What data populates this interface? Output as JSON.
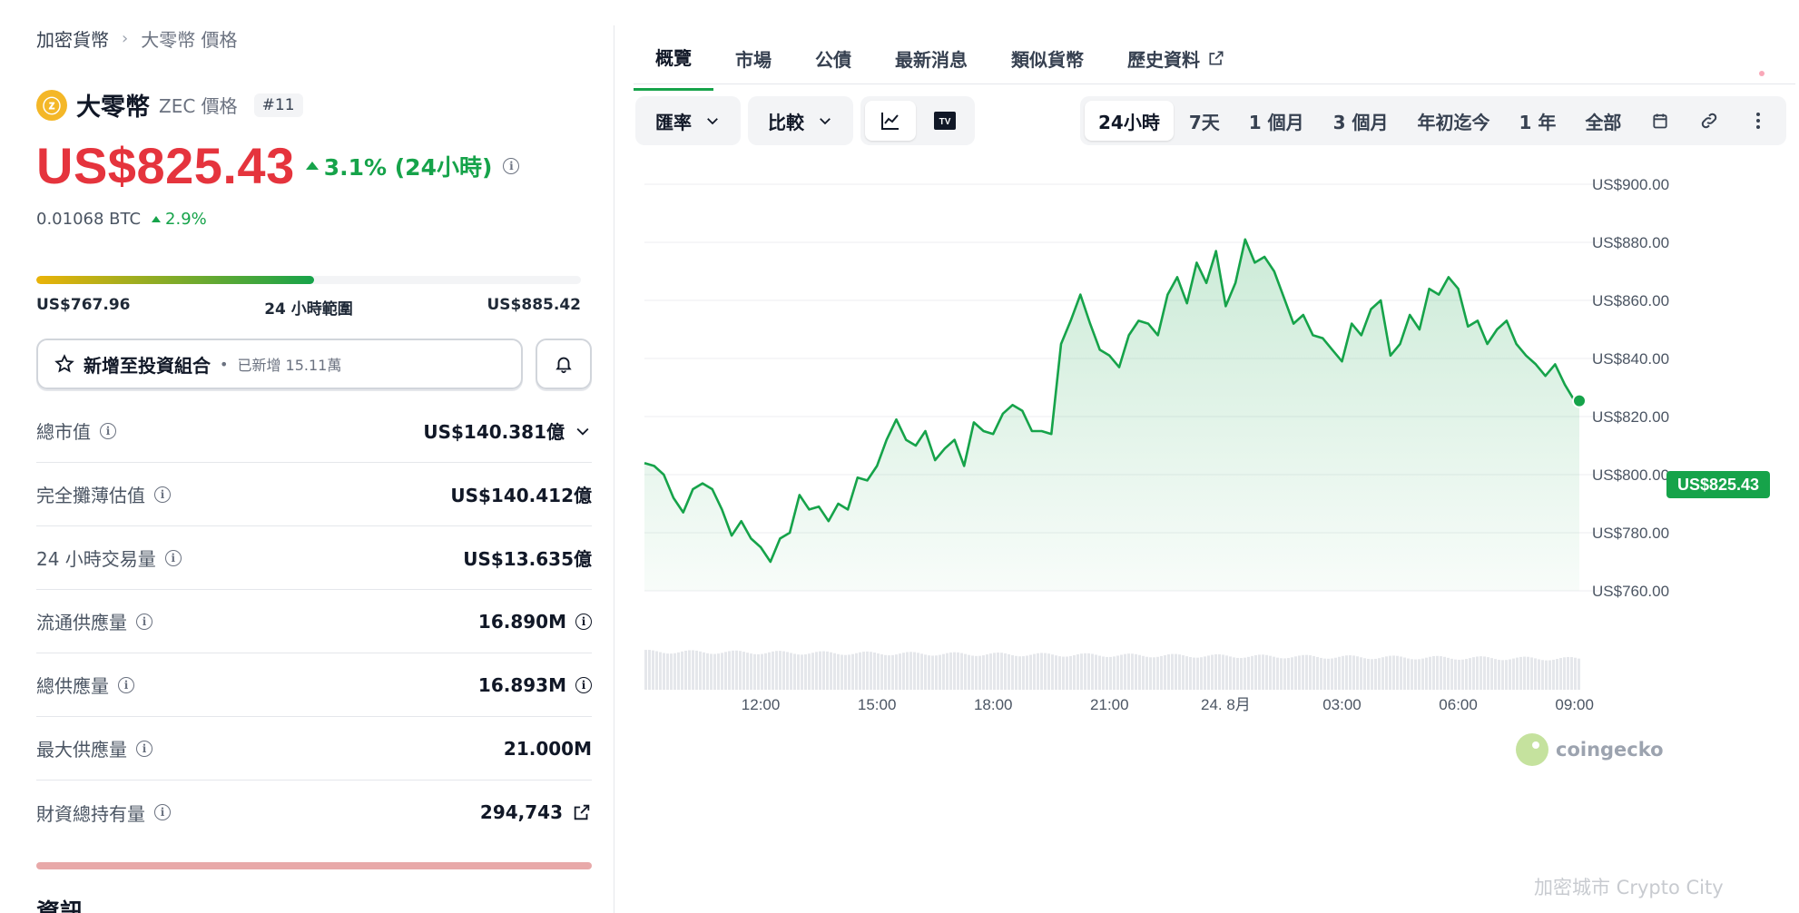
{
  "breadcrumb": {
    "root": "加密貨幣",
    "separator": "›",
    "current": "大零幣 價格"
  },
  "coin": {
    "logo_glyph": "ⓩ",
    "name": "大零幣",
    "symbol_label": "ZEC 價格",
    "rank": "#11",
    "logo_color": "#f4b728"
  },
  "price": {
    "value": "US$825.43",
    "change": "3.1% (24小時)",
    "btc_value": "0.01068 BTC",
    "btc_change": "2.9%"
  },
  "range_24h": {
    "low": "US$767.96",
    "label": "24 小時範圍",
    "high": "US$885.42",
    "position_fraction": 0.51
  },
  "portfolio": {
    "label": "新增至投資組合",
    "bullet": "•",
    "added": "已新增 15.11萬"
  },
  "stats": [
    {
      "key": "總市值",
      "value": "US$140.381億"
    },
    {
      "key": "完全攤薄估值",
      "value": "US$140.412億"
    },
    {
      "key": "24 小時交易量",
      "value": "US$13.635億"
    },
    {
      "key": "流通供應量",
      "value": "16.890M"
    },
    {
      "key": "總供應量",
      "value": "16.893M"
    },
    {
      "key": "最大供應量",
      "value": "21.000M"
    },
    {
      "key": "財資總持有量",
      "value": "294,743"
    }
  ],
  "section_heading": "資訊",
  "tabs": [
    "概覽",
    "市場",
    "公債",
    "最新消息",
    "類似貨幣",
    "歷史資料"
  ],
  "toolbar": {
    "currency_label": "匯率",
    "compare_label": "比較",
    "tv_label": "TV",
    "ranges": [
      "24小時",
      "7天",
      "1 個月",
      "3 個月",
      "年初迄今",
      "1 年",
      "全部"
    ],
    "selected_range": "24小時"
  },
  "chart_data": {
    "type": "line",
    "title": "",
    "xlabel": "",
    "ylabel": "",
    "ylim": [
      760,
      900
    ],
    "y_ticks": [
      "US$900.00",
      "US$880.00",
      "US$860.00",
      "US$840.00",
      "US$820.00",
      "US$800.00",
      "US$780.00",
      "US$760.00"
    ],
    "x_ticks": [
      "12:00",
      "15:00",
      "18:00",
      "21:00",
      "24. 8月",
      "03:00",
      "06:00",
      "09:00"
    ],
    "x_tick_hours": [
      12,
      15,
      18,
      21,
      24,
      27,
      30,
      33
    ],
    "x_hours": [
      9,
      9.25,
      9.5,
      9.75,
      10,
      10.25,
      10.5,
      10.75,
      11,
      11.25,
      11.5,
      11.75,
      12,
      12.25,
      12.5,
      12.75,
      13,
      13.25,
      13.5,
      13.75,
      14,
      14.25,
      14.5,
      14.75,
      15,
      15.25,
      15.5,
      15.75,
      16,
      16.25,
      16.5,
      16.75,
      17,
      17.25,
      17.5,
      17.75,
      18,
      18.25,
      18.5,
      18.75,
      19,
      19.25,
      19.5,
      19.75,
      20,
      20.25,
      20.5,
      20.75,
      21,
      21.25,
      21.5,
      21.75,
      22,
      22.25,
      22.5,
      22.75,
      23,
      23.25,
      23.5,
      23.75,
      24,
      24.25,
      24.5,
      24.75,
      25,
      25.25,
      25.5,
      25.75,
      26,
      26.25,
      26.5,
      26.75,
      27,
      27.25,
      27.5,
      27.75,
      28,
      28.25,
      28.5,
      28.75,
      29,
      29.25,
      29.5,
      29.75,
      30,
      30.25,
      30.5,
      30.75,
      31,
      31.25,
      31.5,
      31.75,
      32,
      32.25,
      32.5,
      32.75,
      33,
      33.125
    ],
    "values": [
      804,
      803,
      800,
      792,
      787,
      795,
      797,
      795,
      788,
      779,
      784,
      778,
      775,
      770,
      778,
      780,
      793,
      788,
      789,
      784,
      790,
      788,
      799,
      798,
      803,
      812,
      819,
      812,
      810,
      815,
      805,
      809,
      812,
      803,
      818,
      815,
      814,
      821,
      824,
      822,
      815,
      815,
      814,
      845,
      853,
      862,
      852,
      843,
      841,
      837,
      848,
      853,
      852,
      848,
      862,
      868,
      859,
      873,
      866,
      877,
      858,
      866,
      881,
      873,
      875,
      870,
      861,
      852,
      855,
      848,
      847,
      843,
      839,
      852,
      848,
      857,
      860,
      841,
      845,
      855,
      850,
      864,
      862,
      868,
      864,
      851,
      853,
      845,
      850,
      853,
      845,
      841,
      838,
      834,
      838,
      831,
      825.43,
      825.43
    ],
    "current_price_label": "US$825.43",
    "line_color": "#16a34a",
    "grid": true
  },
  "watermark": {
    "brand": "coingecko",
    "overlay_text": "加密城市 Crypto City"
  }
}
